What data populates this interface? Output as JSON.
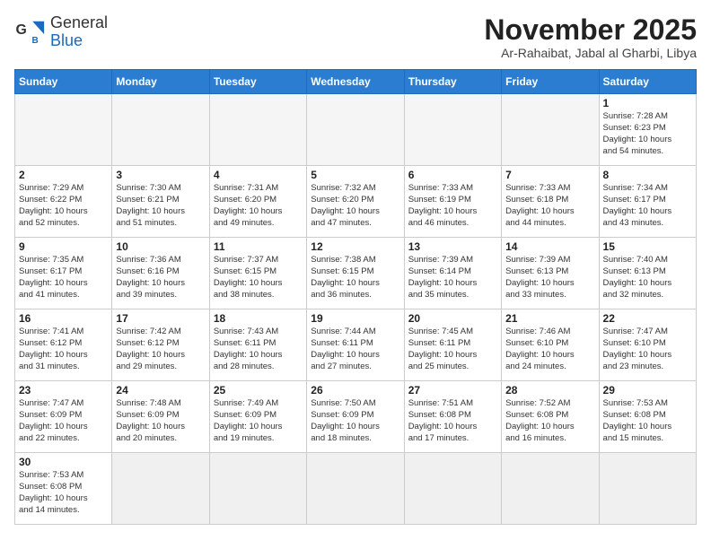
{
  "header": {
    "logo_line1": "General",
    "logo_line2": "Blue",
    "month_title": "November 2025",
    "subtitle": "Ar-Rahaibat, Jabal al Gharbi, Libya"
  },
  "weekdays": [
    "Sunday",
    "Monday",
    "Tuesday",
    "Wednesday",
    "Thursday",
    "Friday",
    "Saturday"
  ],
  "weeks": [
    [
      {
        "day": "",
        "info": ""
      },
      {
        "day": "",
        "info": ""
      },
      {
        "day": "",
        "info": ""
      },
      {
        "day": "",
        "info": ""
      },
      {
        "day": "",
        "info": ""
      },
      {
        "day": "",
        "info": ""
      },
      {
        "day": "1",
        "info": "Sunrise: 7:28 AM\nSunset: 6:23 PM\nDaylight: 10 hours\nand 54 minutes."
      }
    ],
    [
      {
        "day": "2",
        "info": "Sunrise: 7:29 AM\nSunset: 6:22 PM\nDaylight: 10 hours\nand 52 minutes."
      },
      {
        "day": "3",
        "info": "Sunrise: 7:30 AM\nSunset: 6:21 PM\nDaylight: 10 hours\nand 51 minutes."
      },
      {
        "day": "4",
        "info": "Sunrise: 7:31 AM\nSunset: 6:20 PM\nDaylight: 10 hours\nand 49 minutes."
      },
      {
        "day": "5",
        "info": "Sunrise: 7:32 AM\nSunset: 6:20 PM\nDaylight: 10 hours\nand 47 minutes."
      },
      {
        "day": "6",
        "info": "Sunrise: 7:33 AM\nSunset: 6:19 PM\nDaylight: 10 hours\nand 46 minutes."
      },
      {
        "day": "7",
        "info": "Sunrise: 7:33 AM\nSunset: 6:18 PM\nDaylight: 10 hours\nand 44 minutes."
      },
      {
        "day": "8",
        "info": "Sunrise: 7:34 AM\nSunset: 6:17 PM\nDaylight: 10 hours\nand 43 minutes."
      }
    ],
    [
      {
        "day": "9",
        "info": "Sunrise: 7:35 AM\nSunset: 6:17 PM\nDaylight: 10 hours\nand 41 minutes."
      },
      {
        "day": "10",
        "info": "Sunrise: 7:36 AM\nSunset: 6:16 PM\nDaylight: 10 hours\nand 39 minutes."
      },
      {
        "day": "11",
        "info": "Sunrise: 7:37 AM\nSunset: 6:15 PM\nDaylight: 10 hours\nand 38 minutes."
      },
      {
        "day": "12",
        "info": "Sunrise: 7:38 AM\nSunset: 6:15 PM\nDaylight: 10 hours\nand 36 minutes."
      },
      {
        "day": "13",
        "info": "Sunrise: 7:39 AM\nSunset: 6:14 PM\nDaylight: 10 hours\nand 35 minutes."
      },
      {
        "day": "14",
        "info": "Sunrise: 7:39 AM\nSunset: 6:13 PM\nDaylight: 10 hours\nand 33 minutes."
      },
      {
        "day": "15",
        "info": "Sunrise: 7:40 AM\nSunset: 6:13 PM\nDaylight: 10 hours\nand 32 minutes."
      }
    ],
    [
      {
        "day": "16",
        "info": "Sunrise: 7:41 AM\nSunset: 6:12 PM\nDaylight: 10 hours\nand 31 minutes."
      },
      {
        "day": "17",
        "info": "Sunrise: 7:42 AM\nSunset: 6:12 PM\nDaylight: 10 hours\nand 29 minutes."
      },
      {
        "day": "18",
        "info": "Sunrise: 7:43 AM\nSunset: 6:11 PM\nDaylight: 10 hours\nand 28 minutes."
      },
      {
        "day": "19",
        "info": "Sunrise: 7:44 AM\nSunset: 6:11 PM\nDaylight: 10 hours\nand 27 minutes."
      },
      {
        "day": "20",
        "info": "Sunrise: 7:45 AM\nSunset: 6:11 PM\nDaylight: 10 hours\nand 25 minutes."
      },
      {
        "day": "21",
        "info": "Sunrise: 7:46 AM\nSunset: 6:10 PM\nDaylight: 10 hours\nand 24 minutes."
      },
      {
        "day": "22",
        "info": "Sunrise: 7:47 AM\nSunset: 6:10 PM\nDaylight: 10 hours\nand 23 minutes."
      }
    ],
    [
      {
        "day": "23",
        "info": "Sunrise: 7:47 AM\nSunset: 6:09 PM\nDaylight: 10 hours\nand 22 minutes."
      },
      {
        "day": "24",
        "info": "Sunrise: 7:48 AM\nSunset: 6:09 PM\nDaylight: 10 hours\nand 20 minutes."
      },
      {
        "day": "25",
        "info": "Sunrise: 7:49 AM\nSunset: 6:09 PM\nDaylight: 10 hours\nand 19 minutes."
      },
      {
        "day": "26",
        "info": "Sunrise: 7:50 AM\nSunset: 6:09 PM\nDaylight: 10 hours\nand 18 minutes."
      },
      {
        "day": "27",
        "info": "Sunrise: 7:51 AM\nSunset: 6:08 PM\nDaylight: 10 hours\nand 17 minutes."
      },
      {
        "day": "28",
        "info": "Sunrise: 7:52 AM\nSunset: 6:08 PM\nDaylight: 10 hours\nand 16 minutes."
      },
      {
        "day": "29",
        "info": "Sunrise: 7:53 AM\nSunset: 6:08 PM\nDaylight: 10 hours\nand 15 minutes."
      }
    ],
    [
      {
        "day": "30",
        "info": "Sunrise: 7:53 AM\nSunset: 6:08 PM\nDaylight: 10 hours\nand 14 minutes."
      },
      {
        "day": "",
        "info": ""
      },
      {
        "day": "",
        "info": ""
      },
      {
        "day": "",
        "info": ""
      },
      {
        "day": "",
        "info": ""
      },
      {
        "day": "",
        "info": ""
      },
      {
        "day": "",
        "info": ""
      }
    ]
  ]
}
